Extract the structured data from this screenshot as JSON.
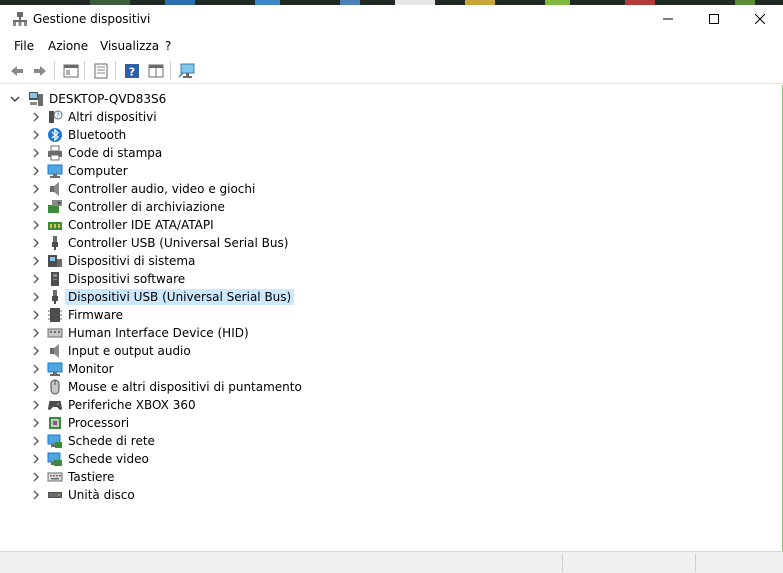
{
  "window": {
    "title": "Gestione dispositivi",
    "controls": {
      "minimize": "minimize-icon",
      "maximize": "maximize-icon",
      "close": "close-icon"
    }
  },
  "menu": [
    "File",
    "Azione",
    "Visualizza",
    "?"
  ],
  "toolbar": {
    "buttons": [
      "back-arrow-icon",
      "forward-arrow-icon",
      "show-hide-tree-icon",
      "properties-icon",
      "help-icon",
      "view-panel-icon",
      "scan-hardware-icon"
    ]
  },
  "tree": {
    "root": "DESKTOP-QVD83S6",
    "items": [
      {
        "label": "Altri dispositivi",
        "icon": "unknown-device-icon"
      },
      {
        "label": "Bluetooth",
        "icon": "bluetooth-icon"
      },
      {
        "label": "Code di stampa",
        "icon": "printer-icon"
      },
      {
        "label": "Computer",
        "icon": "computer-icon"
      },
      {
        "label": "Controller audio, video e giochi",
        "icon": "speaker-icon"
      },
      {
        "label": "Controller di archiviazione",
        "icon": "storage-controller-icon"
      },
      {
        "label": "Controller IDE ATA/ATAPI",
        "icon": "ide-controller-icon"
      },
      {
        "label": "Controller USB (Universal Serial Bus)",
        "icon": "usb-icon"
      },
      {
        "label": "Dispositivi di sistema",
        "icon": "system-device-icon"
      },
      {
        "label": "Dispositivi software",
        "icon": "software-device-icon"
      },
      {
        "label": "Dispositivi USB (Universal Serial Bus)",
        "icon": "usb-device-icon",
        "selected": true
      },
      {
        "label": "Firmware",
        "icon": "firmware-icon"
      },
      {
        "label": "Human Interface Device (HID)",
        "icon": "hid-icon"
      },
      {
        "label": "Input e output audio",
        "icon": "audio-io-icon"
      },
      {
        "label": "Monitor",
        "icon": "monitor-icon"
      },
      {
        "label": "Mouse e altri dispositivi di puntamento",
        "icon": "mouse-icon"
      },
      {
        "label": "Periferiche XBOX 360",
        "icon": "gamepad-icon"
      },
      {
        "label": "Processori",
        "icon": "processor-icon"
      },
      {
        "label": "Schede di rete",
        "icon": "network-adapter-icon"
      },
      {
        "label": "Schede video",
        "icon": "display-adapter-icon"
      },
      {
        "label": "Tastiere",
        "icon": "keyboard-icon"
      },
      {
        "label": "Unità disco",
        "icon": "disk-drive-icon"
      }
    ]
  },
  "colors": {
    "selection": "#cce8ff",
    "accent_blue": "#1e78d4",
    "window_border": "#8fbf7a"
  }
}
